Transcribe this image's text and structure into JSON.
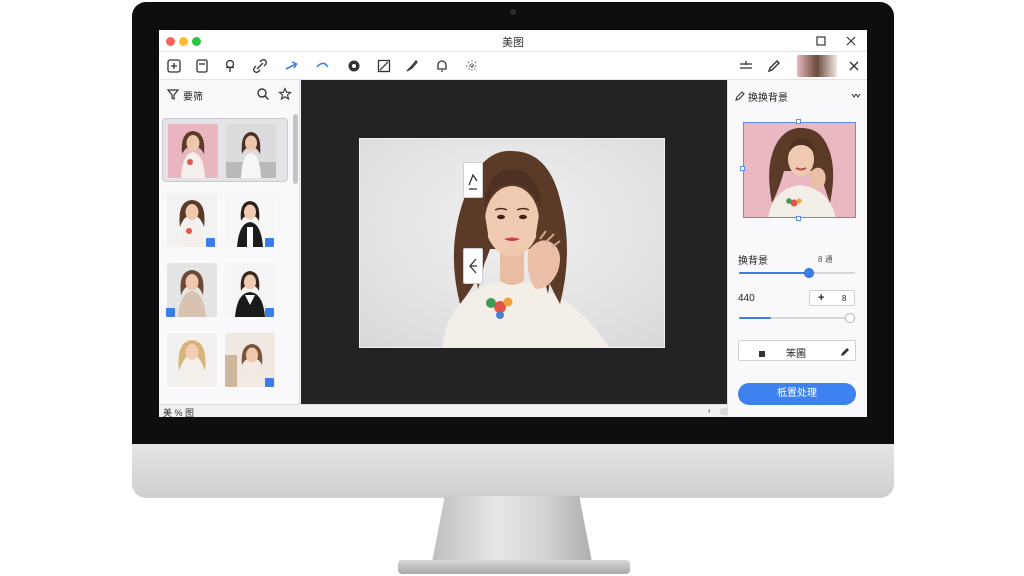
{
  "window": {
    "title": "美图"
  },
  "left_panel": {
    "filter_label": "要筛",
    "footer_text": "美 % 图"
  },
  "right_panel": {
    "title": "换换背景",
    "section_label": "换背景",
    "section_hint": "8 通",
    "value_label": "440",
    "stepper_plus": "+",
    "stepper_alt": "8",
    "tool_label": "笨圖",
    "primary_button": "柢置处理"
  },
  "icons": [
    "folder-add-icon",
    "document-icon",
    "pin-icon",
    "link-icon",
    "arrow-icon",
    "magic-wand-icon",
    "circle-icon",
    "crop-icon",
    "brush-icon",
    "bell-icon",
    "sparkle-icon",
    "adjust-icon",
    "pen-icon",
    "close-icon"
  ],
  "colors": {
    "accent": "#3d82ee",
    "canvas_bg": "#232325",
    "preview_bg": "#e9b8c1"
  }
}
